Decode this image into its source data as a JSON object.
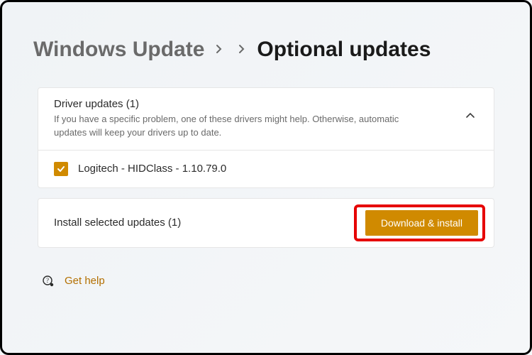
{
  "breadcrumb": {
    "root": "Windows Update",
    "current": "Optional updates"
  },
  "section": {
    "title": "Driver updates (1)",
    "description": "If you have a specific problem, one of these drivers might help. Otherwise, automatic updates will keep your drivers up to date."
  },
  "updates": {
    "item0": "Logitech - HIDClass - 1.10.79.0"
  },
  "install": {
    "summary": "Install selected updates (1)",
    "button": "Download & install"
  },
  "help": {
    "label": "Get help"
  }
}
